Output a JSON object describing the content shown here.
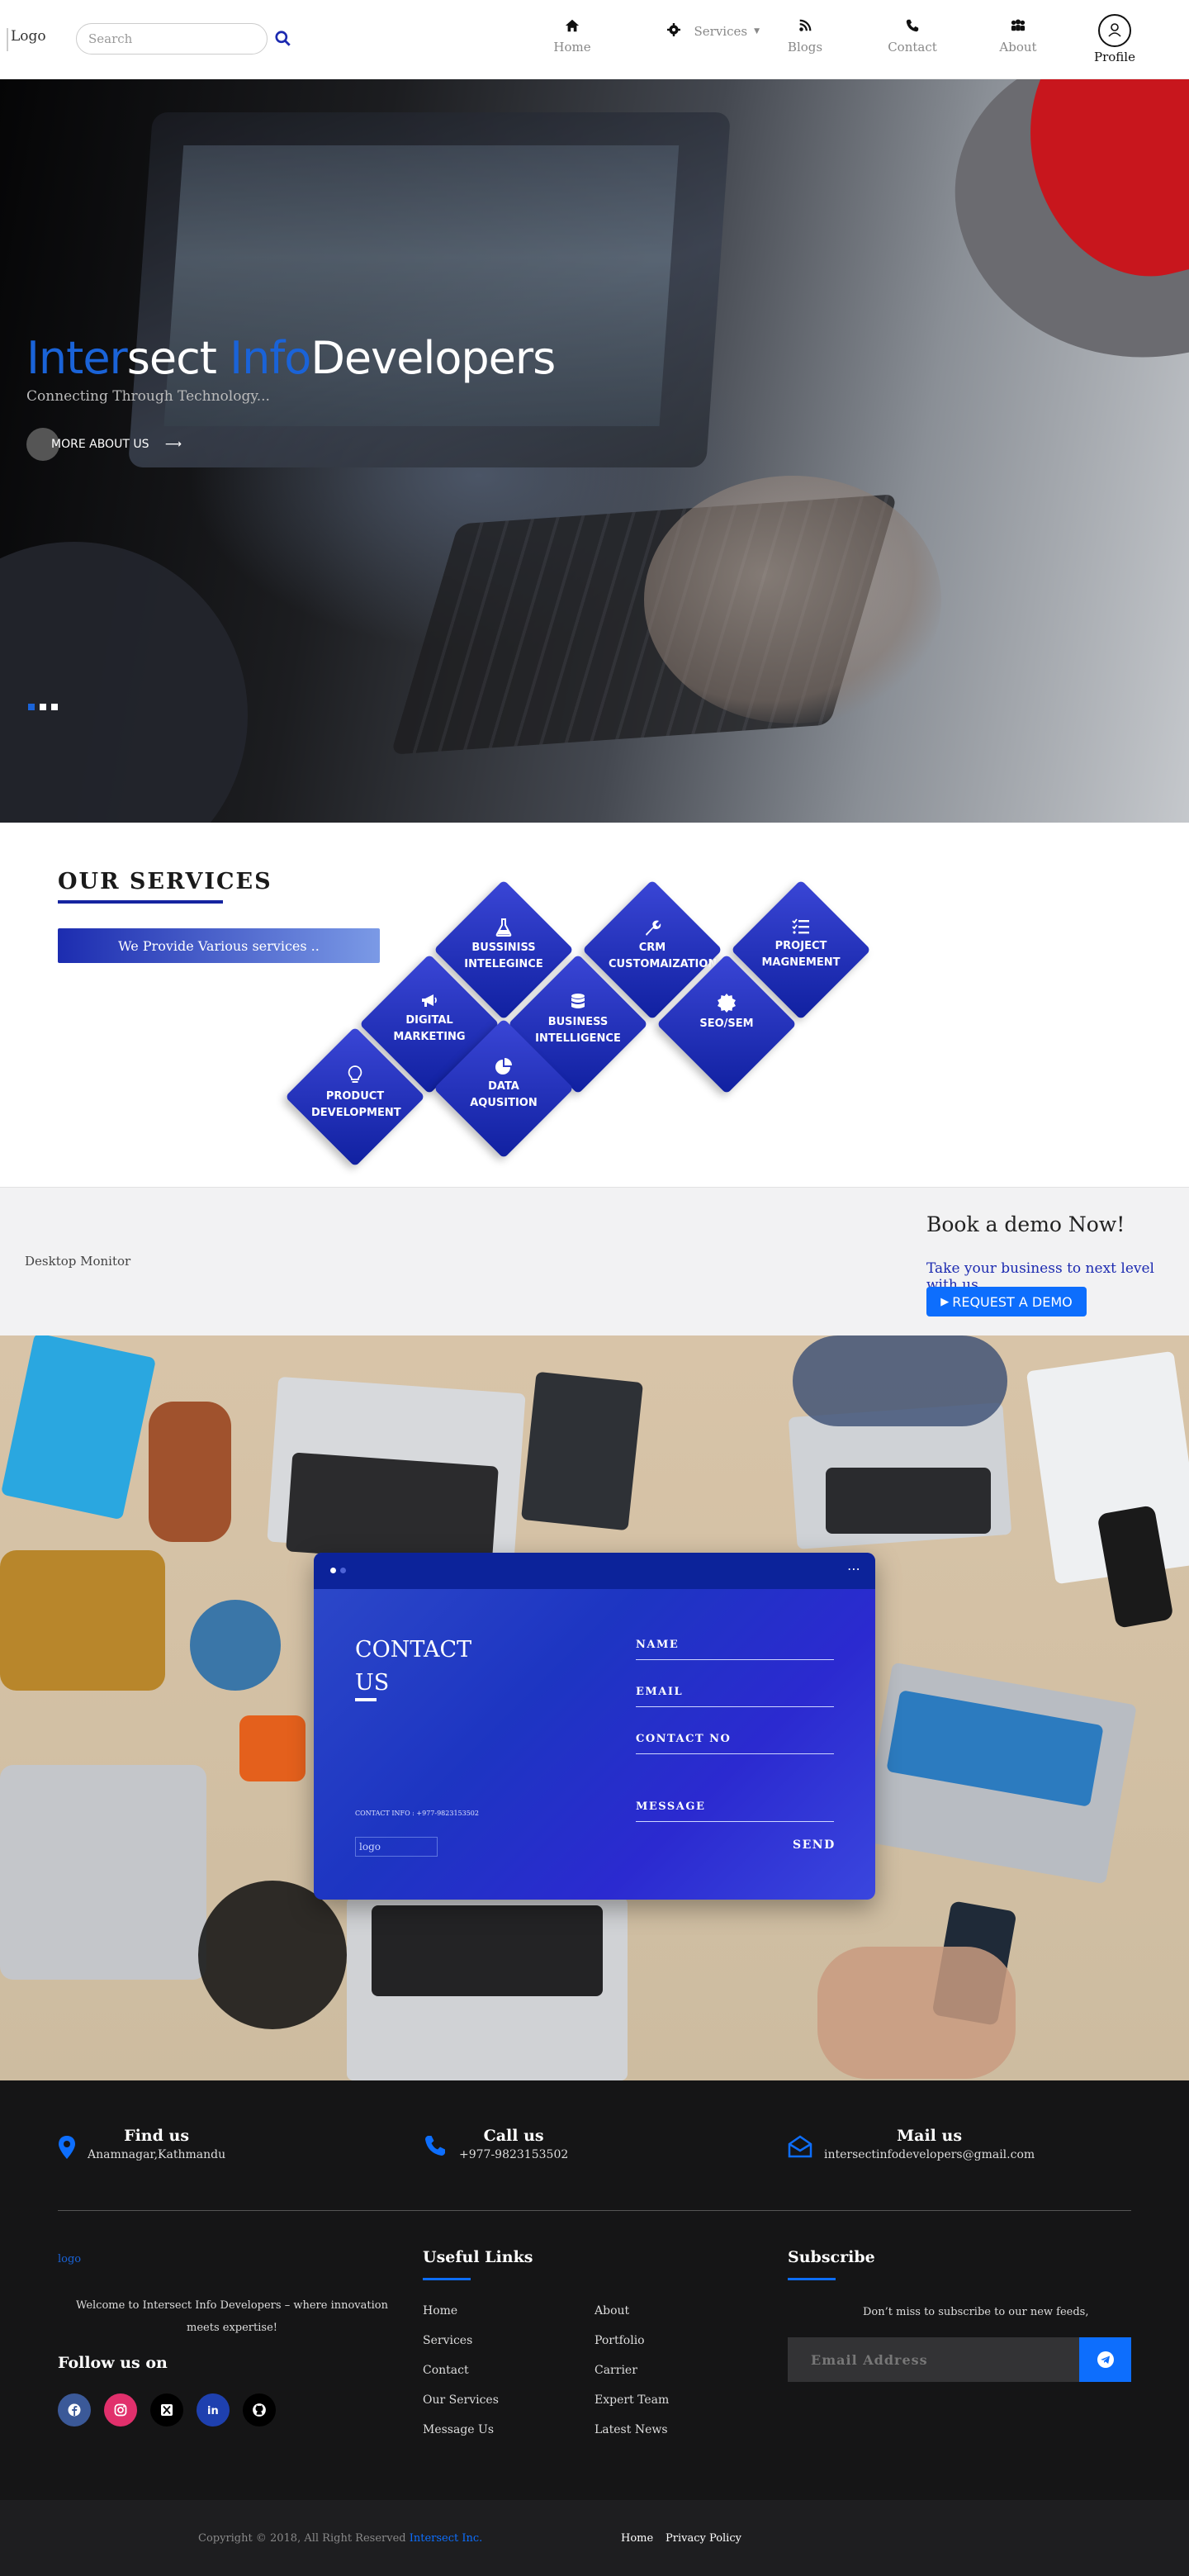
{
  "nav": {
    "logo_alt": "Logo",
    "search_placeholder": "Search",
    "items": [
      {
        "label": "Home",
        "icon": "home-icon"
      },
      {
        "label": "Services",
        "icon": "gear-icon"
      },
      {
        "label": "Blogs",
        "icon": "rss-icon"
      },
      {
        "label": "Contact",
        "icon": "phone-icon"
      },
      {
        "label": "About",
        "icon": "users-icon"
      },
      {
        "label": "Profile",
        "icon": "user-circle-icon"
      }
    ]
  },
  "hero": {
    "title_part1": "Inter",
    "title_part2": "sect ",
    "title_part3": "Info",
    "title_part4": "Developers",
    "subtitle": "Connecting Through Technology...",
    "button_label": "MORE ABOUT US",
    "slides": 3,
    "active_slide": 1
  },
  "services": {
    "title": "OUR SERVICES",
    "banner": "We Provide Various services ..",
    "tiles": [
      {
        "label": "BUSSINISS INTELEGINCE",
        "icon": "flask-icon"
      },
      {
        "label": "CRM CUSTOMAIZATION",
        "icon": "wrench-icon"
      },
      {
        "label": "PROJECT MAGNEMENT",
        "icon": "checklist-icon"
      },
      {
        "label": "DIGITAL MARKETING",
        "icon": "megaphone-icon"
      },
      {
        "label": "BUSINESS INTELLIGENCE",
        "icon": "database-icon"
      },
      {
        "label": "SEO/SEM",
        "icon": "badge-icon"
      },
      {
        "label": "PRODUCT DEVELOPMENT",
        "icon": "lightbulb-icon"
      },
      {
        "label": "DATA AQUSITION",
        "icon": "pie-chart-icon"
      }
    ]
  },
  "demo": {
    "image_alt": "Desktop Monitor",
    "title": "Book a demo Now!",
    "subtitle": "Take your business to next level with us",
    "button_label": "REQUEST A DEMO"
  },
  "contact": {
    "title": "CONTACT US",
    "info": "CONTACT INFO : +977-9823153502",
    "logo_alt": "logo",
    "fields": [
      "NAME",
      "EMAIL",
      "CONTACT NO",
      "MESSAGE"
    ],
    "send_label": "SEND"
  },
  "footer": {
    "find_title": "Find us",
    "find_value": "Anamnagar,Kathmandu",
    "call_title": "Call us",
    "call_value": "+977-9823153502",
    "mail_title": "Mail us",
    "mail_value": "intersectinfodevelopers@gmail.com",
    "logo_alt": "logo",
    "about_text": "Welcome to Intersect Info Developers – where innovation meets expertise!",
    "follow_title": "Follow us on",
    "social": [
      {
        "icon": "facebook-icon",
        "color": "#3b5998"
      },
      {
        "icon": "instagram-icon",
        "color": "#e1306c"
      },
      {
        "icon": "x-icon",
        "color": "#000000"
      },
      {
        "icon": "linkedin-icon",
        "color": "#1e40af"
      },
      {
        "icon": "github-icon",
        "color": "#000000"
      }
    ],
    "useful_title": "Useful Links",
    "links_col1": [
      "Home",
      "Services",
      "Contact",
      "Our Services",
      "Message Us"
    ],
    "links_col2": [
      "About",
      "Portfolio",
      "Carrier",
      "Expert Team",
      "Latest News"
    ],
    "subscribe_title": "Subscribe",
    "subscribe_text": "Don’t miss to subscribe to our new feeds,",
    "email_placeholder": "Email Address"
  },
  "bottom": {
    "copyright": "Copyright © 2018, All Right Reserved ",
    "company": "Intersect Inc.",
    "links": [
      "Home",
      "Privacy Policy"
    ]
  },
  "colors": {
    "accent": "#0d6efd",
    "brand_blue": "#1a63d8",
    "tile_blue": "#1c2cb0",
    "footer_bg": "#151516"
  }
}
